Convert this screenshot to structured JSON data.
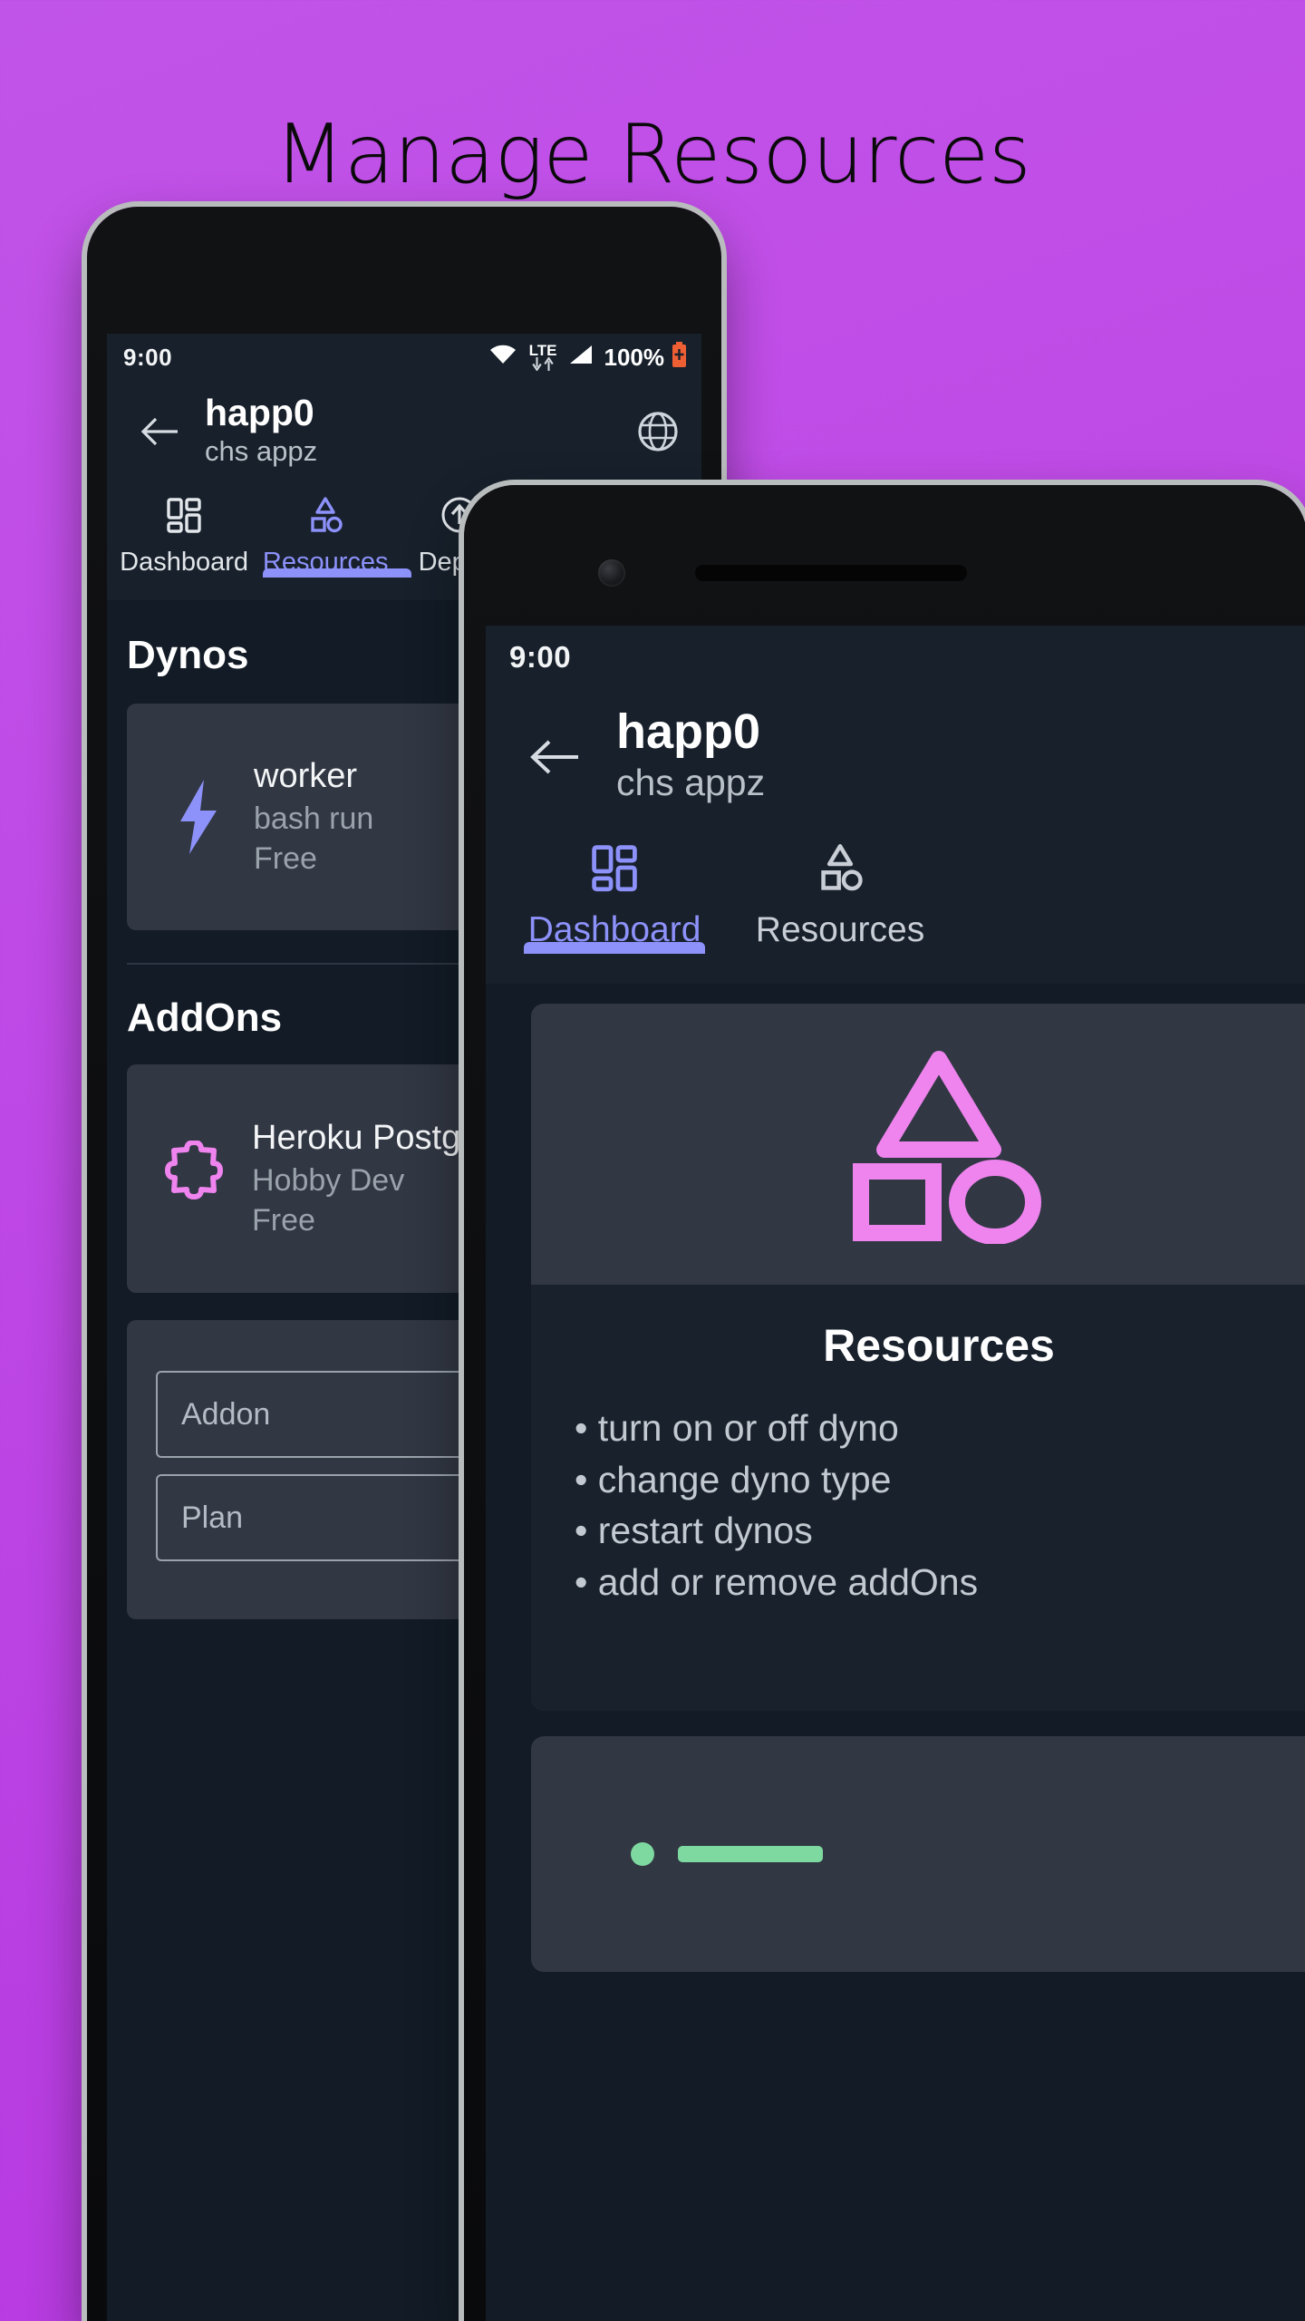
{
  "headline": "Manage Resources",
  "theme": {
    "background_gradient_from": "#c154e8",
    "background_gradient_to": "#b737e0",
    "screen_bg": "#121b26",
    "chrome_bg": "#17202b",
    "card_bg": "#313743",
    "accent_blue": "#8d91fa",
    "accent_pink": "#ef84ef",
    "battery_orange": "#ef5f34",
    "pager_green": "#7ed9a0"
  },
  "phone1": {
    "status_bar": {
      "time": "9:00",
      "wifi_icon": "wifi-icon",
      "network_label": "LTE",
      "data_down_icon": "arrow-down-icon",
      "data_up_icon": "arrow-up-icon",
      "signal_icon": "signal-bars-icon",
      "battery_percent": "100%",
      "battery_icon": "battery-charging-icon"
    },
    "appbar": {
      "back_icon": "arrow-left-icon",
      "title": "happ0",
      "subtitle": "chs appz",
      "action_icon": "globe-icon"
    },
    "tabs": [
      {
        "label": "Dashboard",
        "icon": "dashboard-grid-icon",
        "active": false
      },
      {
        "label": "Resources",
        "icon": "shapes-icon",
        "active": true
      },
      {
        "label": "Deploy",
        "icon": "upload-circle-icon",
        "active": false
      },
      {
        "label": "",
        "icon": "list-icon",
        "active": false
      },
      {
        "label": "",
        "icon": "settings-dots-icon",
        "active": false
      }
    ],
    "sections": [
      {
        "heading": "Dynos",
        "cards": [
          {
            "icon": "lightning-bolt-icon",
            "title": "worker",
            "line2": "bash run",
            "line3": "Free"
          }
        ]
      },
      {
        "heading": "AddOns",
        "cards": [
          {
            "icon": "puzzle-piece-icon",
            "title": "Heroku Postgres",
            "line2": "Hobby Dev",
            "line3": "Free"
          }
        ]
      }
    ],
    "add_addon_form": {
      "addon_placeholder": "Addon",
      "plan_placeholder": "Plan"
    }
  },
  "phone2": {
    "status_bar": {
      "time": "9:00"
    },
    "appbar": {
      "back_icon": "arrow-left-icon",
      "title": "happ0",
      "subtitle": "chs appz"
    },
    "tabs": [
      {
        "label": "Dashboard",
        "icon": "dashboard-grid-icon",
        "active": true
      },
      {
        "label": "Resources",
        "icon": "shapes-icon",
        "active": false
      }
    ],
    "feature_card": {
      "art_icon": "shapes-icon",
      "title": "Resources",
      "bullets": [
        "• turn on or off dyno",
        "• change dyno type",
        "• restart dynos",
        "• add or remove addOns"
      ]
    },
    "pager": {
      "dot_icon": "page-dot-active",
      "bar_icon": "page-progress-bar"
    }
  }
}
